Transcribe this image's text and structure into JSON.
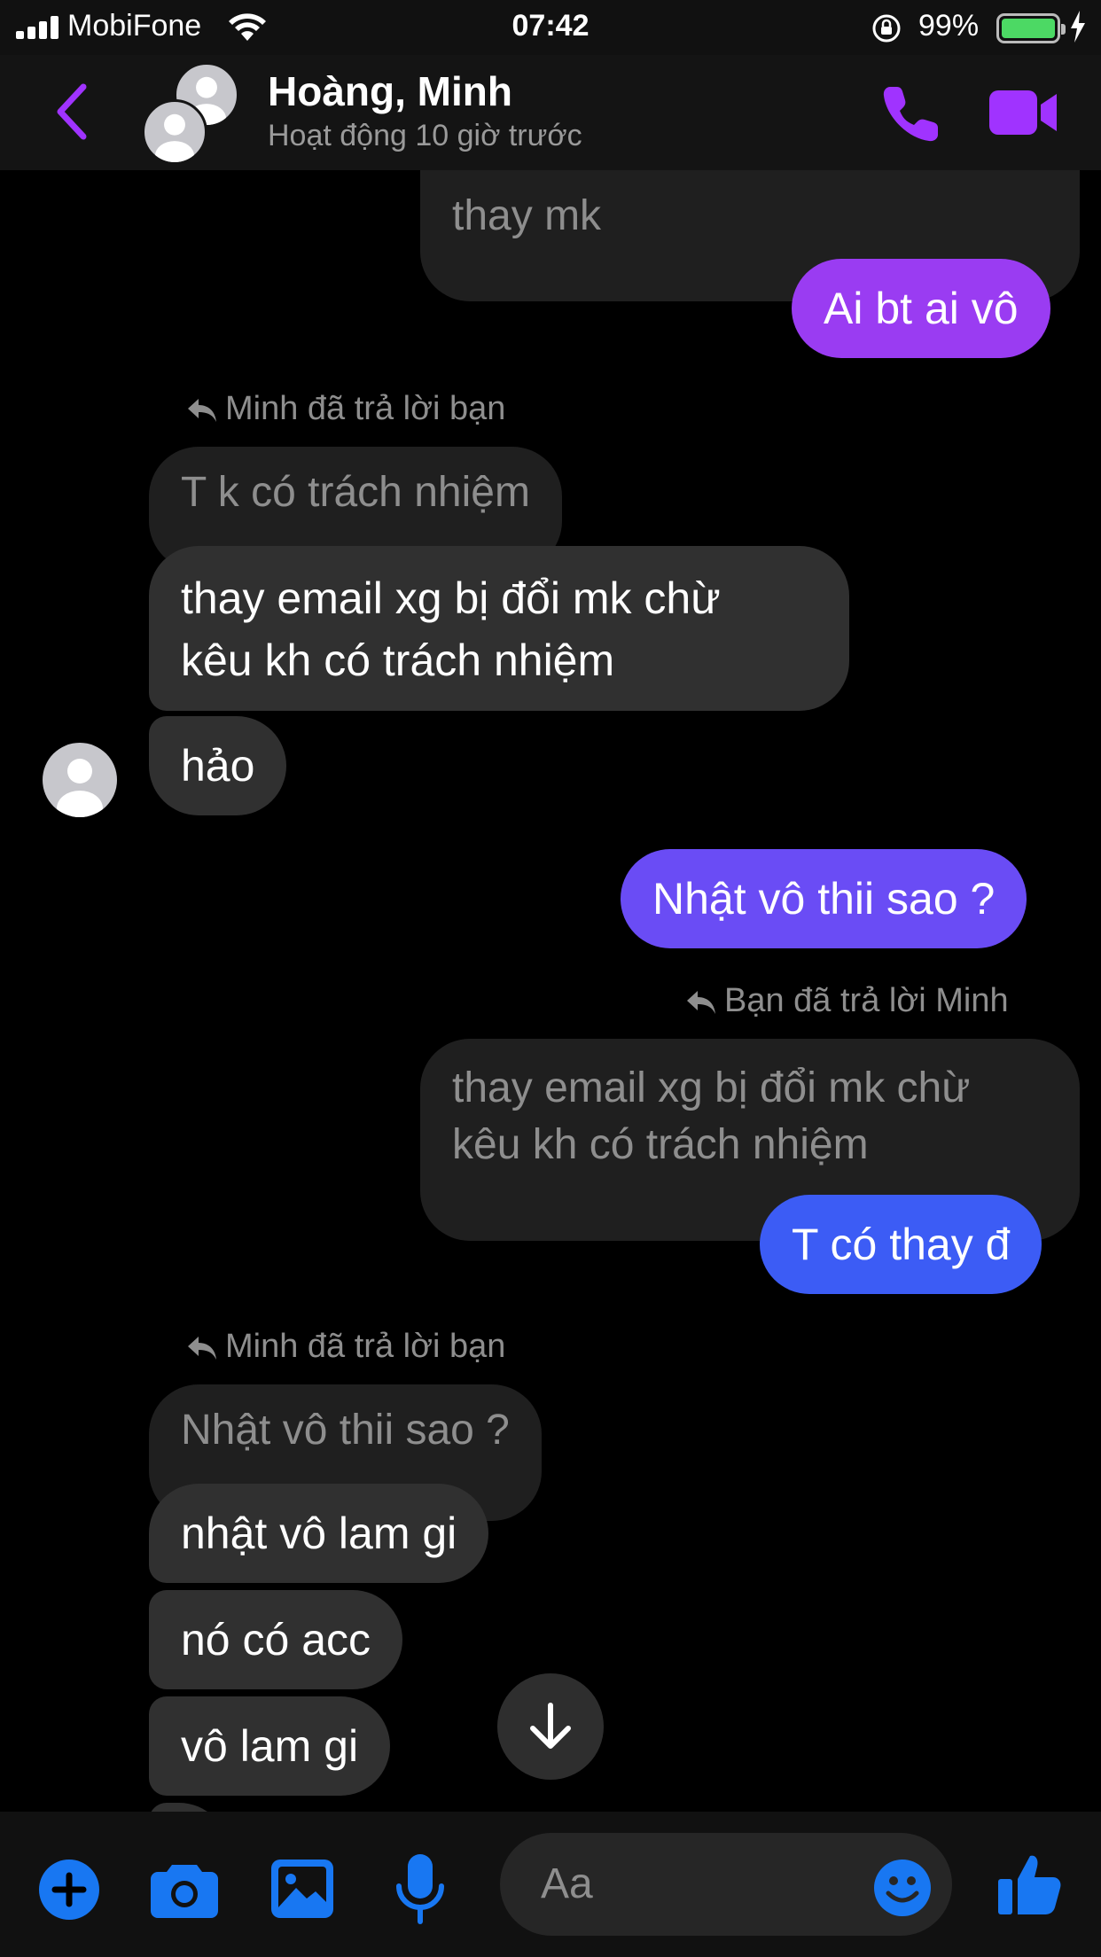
{
  "status_bar": {
    "carrier": "MobiFone",
    "time": "07:42",
    "battery": "99%",
    "battery_color": "#4cd964"
  },
  "header": {
    "name": "Hoàng, Minh",
    "subtitle": "Hoạt động 10 giờ trước",
    "icons": [
      "back-icon",
      "phone-icon",
      "video-icon"
    ],
    "accent_color": "#a033ff"
  },
  "messages": {
    "top_quote_text": "thay mk",
    "m1": "Ai bt ai vô",
    "reply_note_1": "Minh đã trả lời bạn",
    "quote_1": "T k có trách nhiệm",
    "m2_line1": "thay email xg bị đổi mk chừ",
    "m2_line2": "kêu kh có trách nhiệm",
    "m3": "hảo",
    "m4": "Nhật vô thii sao ?",
    "reply_note_2": "Bạn đã trả lời Minh",
    "quote_2_line1": "thay email xg bị đổi mk chừ",
    "quote_2_line2": "kêu kh có trách nhiệm",
    "m5": "T có thay đ",
    "reply_note_3": "Minh đã trả lời bạn",
    "quote_3": "Nhật vô thii sao ?",
    "m6": "nhật vô lam gi",
    "m7": "nó có acc",
    "m8": "vô lam gi"
  },
  "composer": {
    "placeholder": "Aa",
    "icons": [
      "plus-icon",
      "camera-icon",
      "photo-icon",
      "mic-icon",
      "emoji-icon",
      "thumbs-up-icon"
    ],
    "icon_color": "#1877f2"
  }
}
